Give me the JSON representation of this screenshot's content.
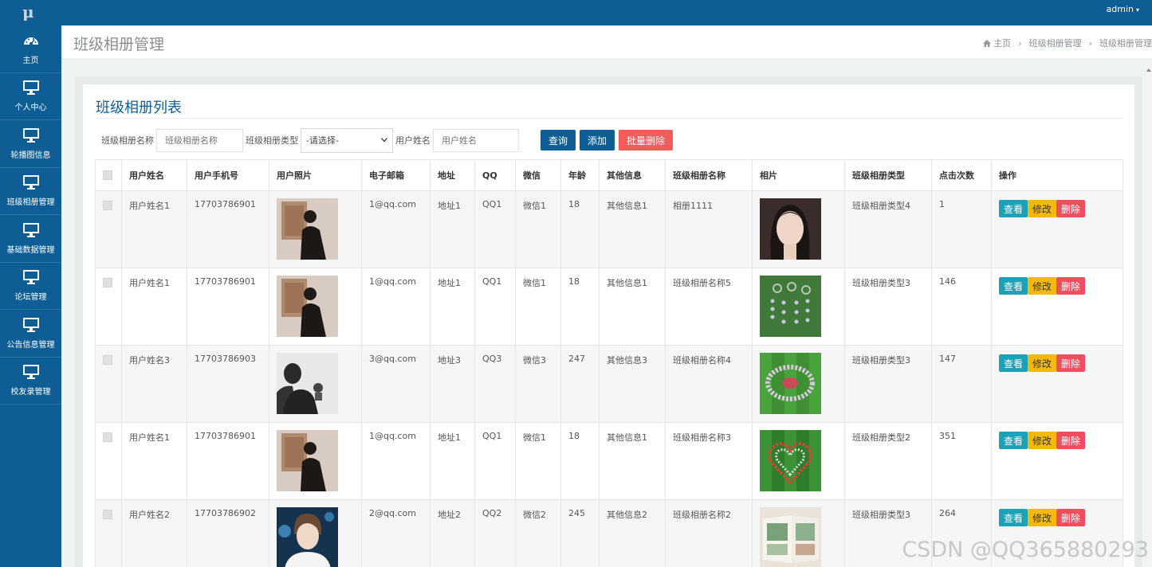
{
  "topbar": {
    "logo": "μ",
    "user": "admin",
    "caret": "▾"
  },
  "sidebar": {
    "items": [
      {
        "label": "主页",
        "icon": "dashboard-icon"
      },
      {
        "label": "个人中心",
        "icon": "monitor-icon"
      },
      {
        "label": "轮播图信息",
        "icon": "monitor-icon"
      },
      {
        "label": "班级相册管理",
        "icon": "monitor-icon"
      },
      {
        "label": "基础数据管理",
        "icon": "monitor-icon"
      },
      {
        "label": "论坛管理",
        "icon": "monitor-icon"
      },
      {
        "label": "公告信息管理",
        "icon": "monitor-icon"
      },
      {
        "label": "校友录管理",
        "icon": "monitor-icon"
      }
    ]
  },
  "header": {
    "title": "班级相册管理",
    "breadcrumb": [
      "主页",
      "班级相册管理",
      "班级相册管理"
    ],
    "home_icon": "home-icon"
  },
  "panel": {
    "title": "班级相册列表"
  },
  "filters": {
    "name_label": "班级相册名称",
    "name_placeholder": "班级相册名称",
    "type_label": "班级相册类型",
    "type_selected": "-请选择-",
    "user_label": "用户姓名",
    "user_placeholder": "用户姓名",
    "query_btn": "查询",
    "add_btn": "添加",
    "batch_delete_btn": "批量删除"
  },
  "table": {
    "columns": [
      "用户姓名",
      "用户手机号",
      "用户照片",
      "电子邮箱",
      "地址",
      "QQ",
      "微信",
      "年龄",
      "其他信息",
      "班级相册名称",
      "相片",
      "班级相册类型",
      "点击次数",
      "操作"
    ],
    "actions": {
      "view": "查看",
      "edit": "修改",
      "delete": "删除"
    },
    "rows": [
      {
        "name": "用户姓名1",
        "phone": "17703786901",
        "avatar": "woman-gallery",
        "email": "1@qq.com",
        "address": "地址1",
        "qq": "QQ1",
        "wechat": "微信1",
        "age": "18",
        "other": "其他信息1",
        "album": "相册1111",
        "photo": "girl-portrait",
        "type": "班级相册类型4",
        "clicks": "1"
      },
      {
        "name": "用户姓名1",
        "phone": "17703786901",
        "avatar": "woman-gallery",
        "email": "1@qq.com",
        "address": "地址1",
        "qq": "QQ1",
        "wechat": "微信1",
        "age": "18",
        "other": "其他信息1",
        "album": "班级相册名称5",
        "photo": "field-formation",
        "type": "班级相册类型3",
        "clicks": "146"
      },
      {
        "name": "用户姓名3",
        "phone": "17703786903",
        "avatar": "man-silhouette",
        "email": "3@qq.com",
        "address": "地址3",
        "qq": "QQ3",
        "wechat": "微信3",
        "age": "247",
        "other": "其他信息3",
        "album": "班级相册名称4",
        "photo": "field-circle",
        "type": "班级相册类型3",
        "clicks": "147"
      },
      {
        "name": "用户姓名1",
        "phone": "17703786901",
        "avatar": "woman-gallery",
        "email": "1@qq.com",
        "address": "地址1",
        "qq": "QQ1",
        "wechat": "微信1",
        "age": "18",
        "other": "其他信息1",
        "album": "班级相册名称3",
        "photo": "field-heart",
        "type": "班级相册类型2",
        "clicks": "351"
      },
      {
        "name": "用户姓名2",
        "phone": "17703786902",
        "avatar": "young-man",
        "email": "2@qq.com",
        "address": "地址2",
        "qq": "QQ2",
        "wechat": "微信2",
        "age": "245",
        "other": "其他信息2",
        "album": "班级相册名称2",
        "photo": "photo-book",
        "type": "班级相册类型3",
        "clicks": "264"
      }
    ]
  },
  "watermark": "CSDN @QQ365880293",
  "colors": {
    "primary": "#0e5d94",
    "danger": "#f45b5b",
    "view": "#1ba2b8",
    "edit": "#f5b80c",
    "delete": "#f04e5e"
  }
}
